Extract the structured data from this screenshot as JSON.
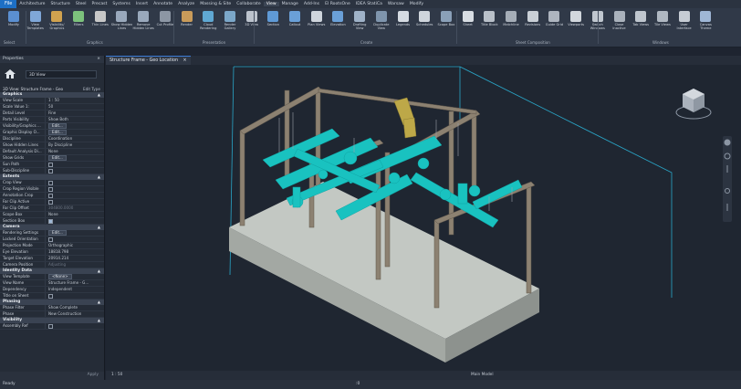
{
  "menubar": {
    "file": "File",
    "tabs": [
      "Architecture",
      "Structure",
      "Steel",
      "Precast",
      "Systems",
      "Insert",
      "Annotate",
      "Analyze",
      "Massing & Site",
      "Collaborate",
      "View",
      "Manage",
      "Add-Ins",
      "El RootsOne",
      "IDEA StatiCa",
      "Warsaw",
      "Modify"
    ],
    "active_tab": "View"
  },
  "ribbon": {
    "buttons": [
      "Modify",
      "View Templates",
      "Visibility/ Graphics",
      "Filters",
      "Thin Lines",
      "Show Hidden Lines",
      "Remove Hidden Lines",
      "Cut Profile",
      "Render",
      "Cloud Rendering",
      "Render Gallery",
      "3D View",
      "Section",
      "Callout",
      "Plan Views",
      "Elevation",
      "Drafting View",
      "Duplicate View",
      "Legends",
      "Schedules",
      "Scope Box",
      "Sheet",
      "Title Block",
      "Matchline",
      "Revisions",
      "Guide Grid",
      "Viewports",
      "Switch Windows",
      "Close Inactive",
      "Tab Views",
      "Tile Views",
      "User Interface",
      "Canvas Theme"
    ],
    "groups": [
      "Select",
      "Graphics",
      "Presentation",
      "Create",
      "Sheet Composition",
      "Windows"
    ],
    "small_items": [
      "View Reference",
      "Matchline",
      "Viewports"
    ]
  },
  "view_tab": {
    "label": "Structure Frame - Geo Location",
    "close": "×"
  },
  "properties": {
    "title": "Properties",
    "close": "×",
    "type_selector": "3D View",
    "filter_text": "3D View: Structure Frame - Geo",
    "edit_type": "Edit Type",
    "categories": [
      {
        "name": "Graphics",
        "rows": [
          {
            "name": "View Scale",
            "value": "1 : 50"
          },
          {
            "name": "Scale Value    1:",
            "value": "50"
          },
          {
            "name": "Detail Level",
            "value": "Fine"
          },
          {
            "name": "Parts Visibility",
            "value": "Show Both"
          },
          {
            "name": "Visibility/Graphics ...",
            "value": "Edit..."
          },
          {
            "name": "Graphic Display O...",
            "value": "Edit..."
          },
          {
            "name": "Discipline",
            "value": "Coordination"
          },
          {
            "name": "Show Hidden Lines",
            "value": "By Discipline"
          },
          {
            "name": "Default Analysis Di...",
            "value": "None"
          },
          {
            "name": "Show Grids",
            "value": "Edit..."
          },
          {
            "name": "Sun Path",
            "value": ""
          },
          {
            "name": "Sub-Discipline",
            "value": ""
          }
        ]
      },
      {
        "name": "Extents",
        "rows": [
          {
            "name": "Crop View",
            "value": ""
          },
          {
            "name": "Crop Region Visible",
            "value": ""
          },
          {
            "name": "Annotation Crop",
            "value": ""
          },
          {
            "name": "Far Clip Active",
            "value": ""
          },
          {
            "name": "Far Clip Offset",
            "value": "304800.0000"
          },
          {
            "name": "Scope Box",
            "value": "None"
          },
          {
            "name": "Section Box",
            "value": ""
          }
        ]
      },
      {
        "name": "Camera",
        "rows": [
          {
            "name": "Rendering Settings",
            "value": "Edit..."
          },
          {
            "name": "Locked Orientation",
            "value": ""
          },
          {
            "name": "Projection Mode",
            "value": "Orthographic"
          },
          {
            "name": "Eye Elevation",
            "value": "18818.798"
          },
          {
            "name": "Target Elevation",
            "value": "20914.214"
          },
          {
            "name": "Camera Position",
            "value": "Adjusting"
          }
        ]
      },
      {
        "name": "Identity Data",
        "rows": [
          {
            "name": "View Template",
            "value": "<None>"
          },
          {
            "name": "View Name",
            "value": "Structure Frame - G..."
          },
          {
            "name": "Dependency",
            "value": "Independent"
          },
          {
            "name": "Title on Sheet",
            "value": ""
          }
        ]
      },
      {
        "name": "Phasing",
        "rows": [
          {
            "name": "Phase Filter",
            "value": "Show Complete"
          },
          {
            "name": "Phase",
            "value": "New Construction"
          }
        ]
      },
      {
        "name": "Visibility",
        "rows": [
          {
            "name": "Assembly Ref",
            "value": ""
          }
        ]
      }
    ],
    "apply": "Apply"
  },
  "view_control": {
    "scale": "1 : 50",
    "main_model": "Main Model"
  },
  "status": {
    "text": "Ready",
    "zoom": ":0"
  },
  "colors": {
    "pipe": "#19c2c0",
    "steel": "#8a7f70",
    "slab": "#c9cdc8",
    "accent": "#1d6fc4"
  }
}
